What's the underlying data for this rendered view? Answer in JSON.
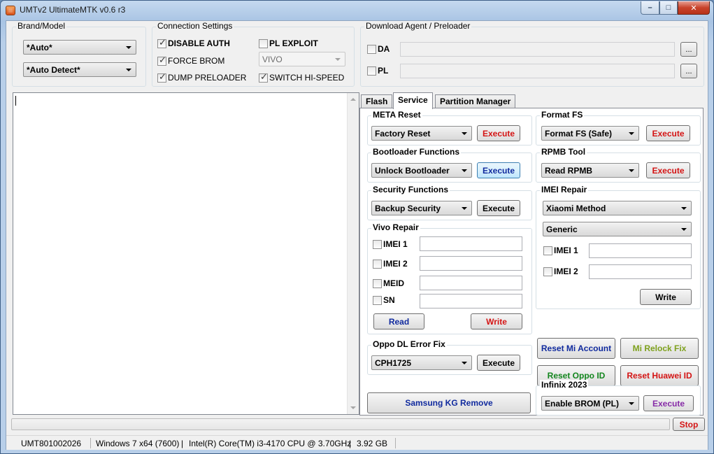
{
  "window": {
    "title": "UMTv2 UltimateMTK v0.6 r3"
  },
  "brand_model": {
    "title": "Brand/Model",
    "brand_value": "*Auto*",
    "model_value": "*Auto Detect*"
  },
  "connection": {
    "title": "Connection Settings",
    "disable_auth": {
      "label": "DISABLE AUTH",
      "checked": true
    },
    "force_brom": {
      "label": "FORCE BROM",
      "checked": true
    },
    "dump_preloader": {
      "label": "DUMP PRELOADER",
      "checked": true
    },
    "pl_exploit": {
      "label": "PL EXPLOIT",
      "checked": false
    },
    "exploit_target": "VIVO",
    "switch_hispeed": {
      "label": "SWITCH HI-SPEED",
      "checked": true
    }
  },
  "download_agent": {
    "title": "Download Agent / Preloader",
    "da_label": "DA",
    "pl_label": "PL",
    "browse_label": "..."
  },
  "tabs": [
    {
      "label": "Flash"
    },
    {
      "label": "Service"
    },
    {
      "label": "Partition Manager"
    }
  ],
  "service": {
    "meta_reset": {
      "title": "META Reset",
      "value": "Factory Reset",
      "execute": "Execute"
    },
    "format_fs": {
      "title": "Format FS",
      "value": "Format FS (Safe)",
      "execute": "Execute"
    },
    "bootloader": {
      "title": "Bootloader Functions",
      "value": "Unlock Bootloader",
      "execute": "Execute"
    },
    "rpmb": {
      "title": "RPMB Tool",
      "value": "Read RPMB",
      "execute": "Execute"
    },
    "security": {
      "title": "Security Functions",
      "value": "Backup Security",
      "execute": "Execute"
    },
    "imei_repair": {
      "title": "IMEI Repair",
      "method": "Xiaomi Method",
      "variant": "Generic",
      "imei1_label": "IMEI 1",
      "imei2_label": "IMEI 2",
      "write": "Write"
    },
    "vivo_repair": {
      "title": "Vivo Repair",
      "imei1_label": "IMEI 1",
      "imei2_label": "IMEI 2",
      "meid_label": "MEID",
      "sn_label": "SN",
      "read": "Read",
      "write": "Write"
    },
    "reset_mi_account": "Reset Mi Account",
    "mi_relock_fix": "Mi Relock Fix",
    "reset_oppo_id": "Reset Oppo ID",
    "reset_huawei_id": "Reset Huawei ID",
    "oppo_dl": {
      "title": "Oppo DL Error Fix",
      "value": "CPH1725",
      "execute": "Execute"
    },
    "samsung_kg": "Samsung KG Remove",
    "infinix": {
      "title": "Infinix 2023",
      "value": "Enable BROM (PL)",
      "execute": "Execute"
    }
  },
  "progress": {
    "value": 0,
    "stop_label": "Stop"
  },
  "status": {
    "serial": "UMT801002026",
    "os": "Windows 7 x64 (7600)",
    "cpu": "Intel(R) Core(TM) i3-4170 CPU @ 3.70GHz",
    "ram": "3.92 GB"
  },
  "colors": {
    "execute_red": "#d41414",
    "execute_blue": "#102a9e",
    "green": "#13861e",
    "olive": "#7ea11d",
    "purple": "#872ba7"
  }
}
